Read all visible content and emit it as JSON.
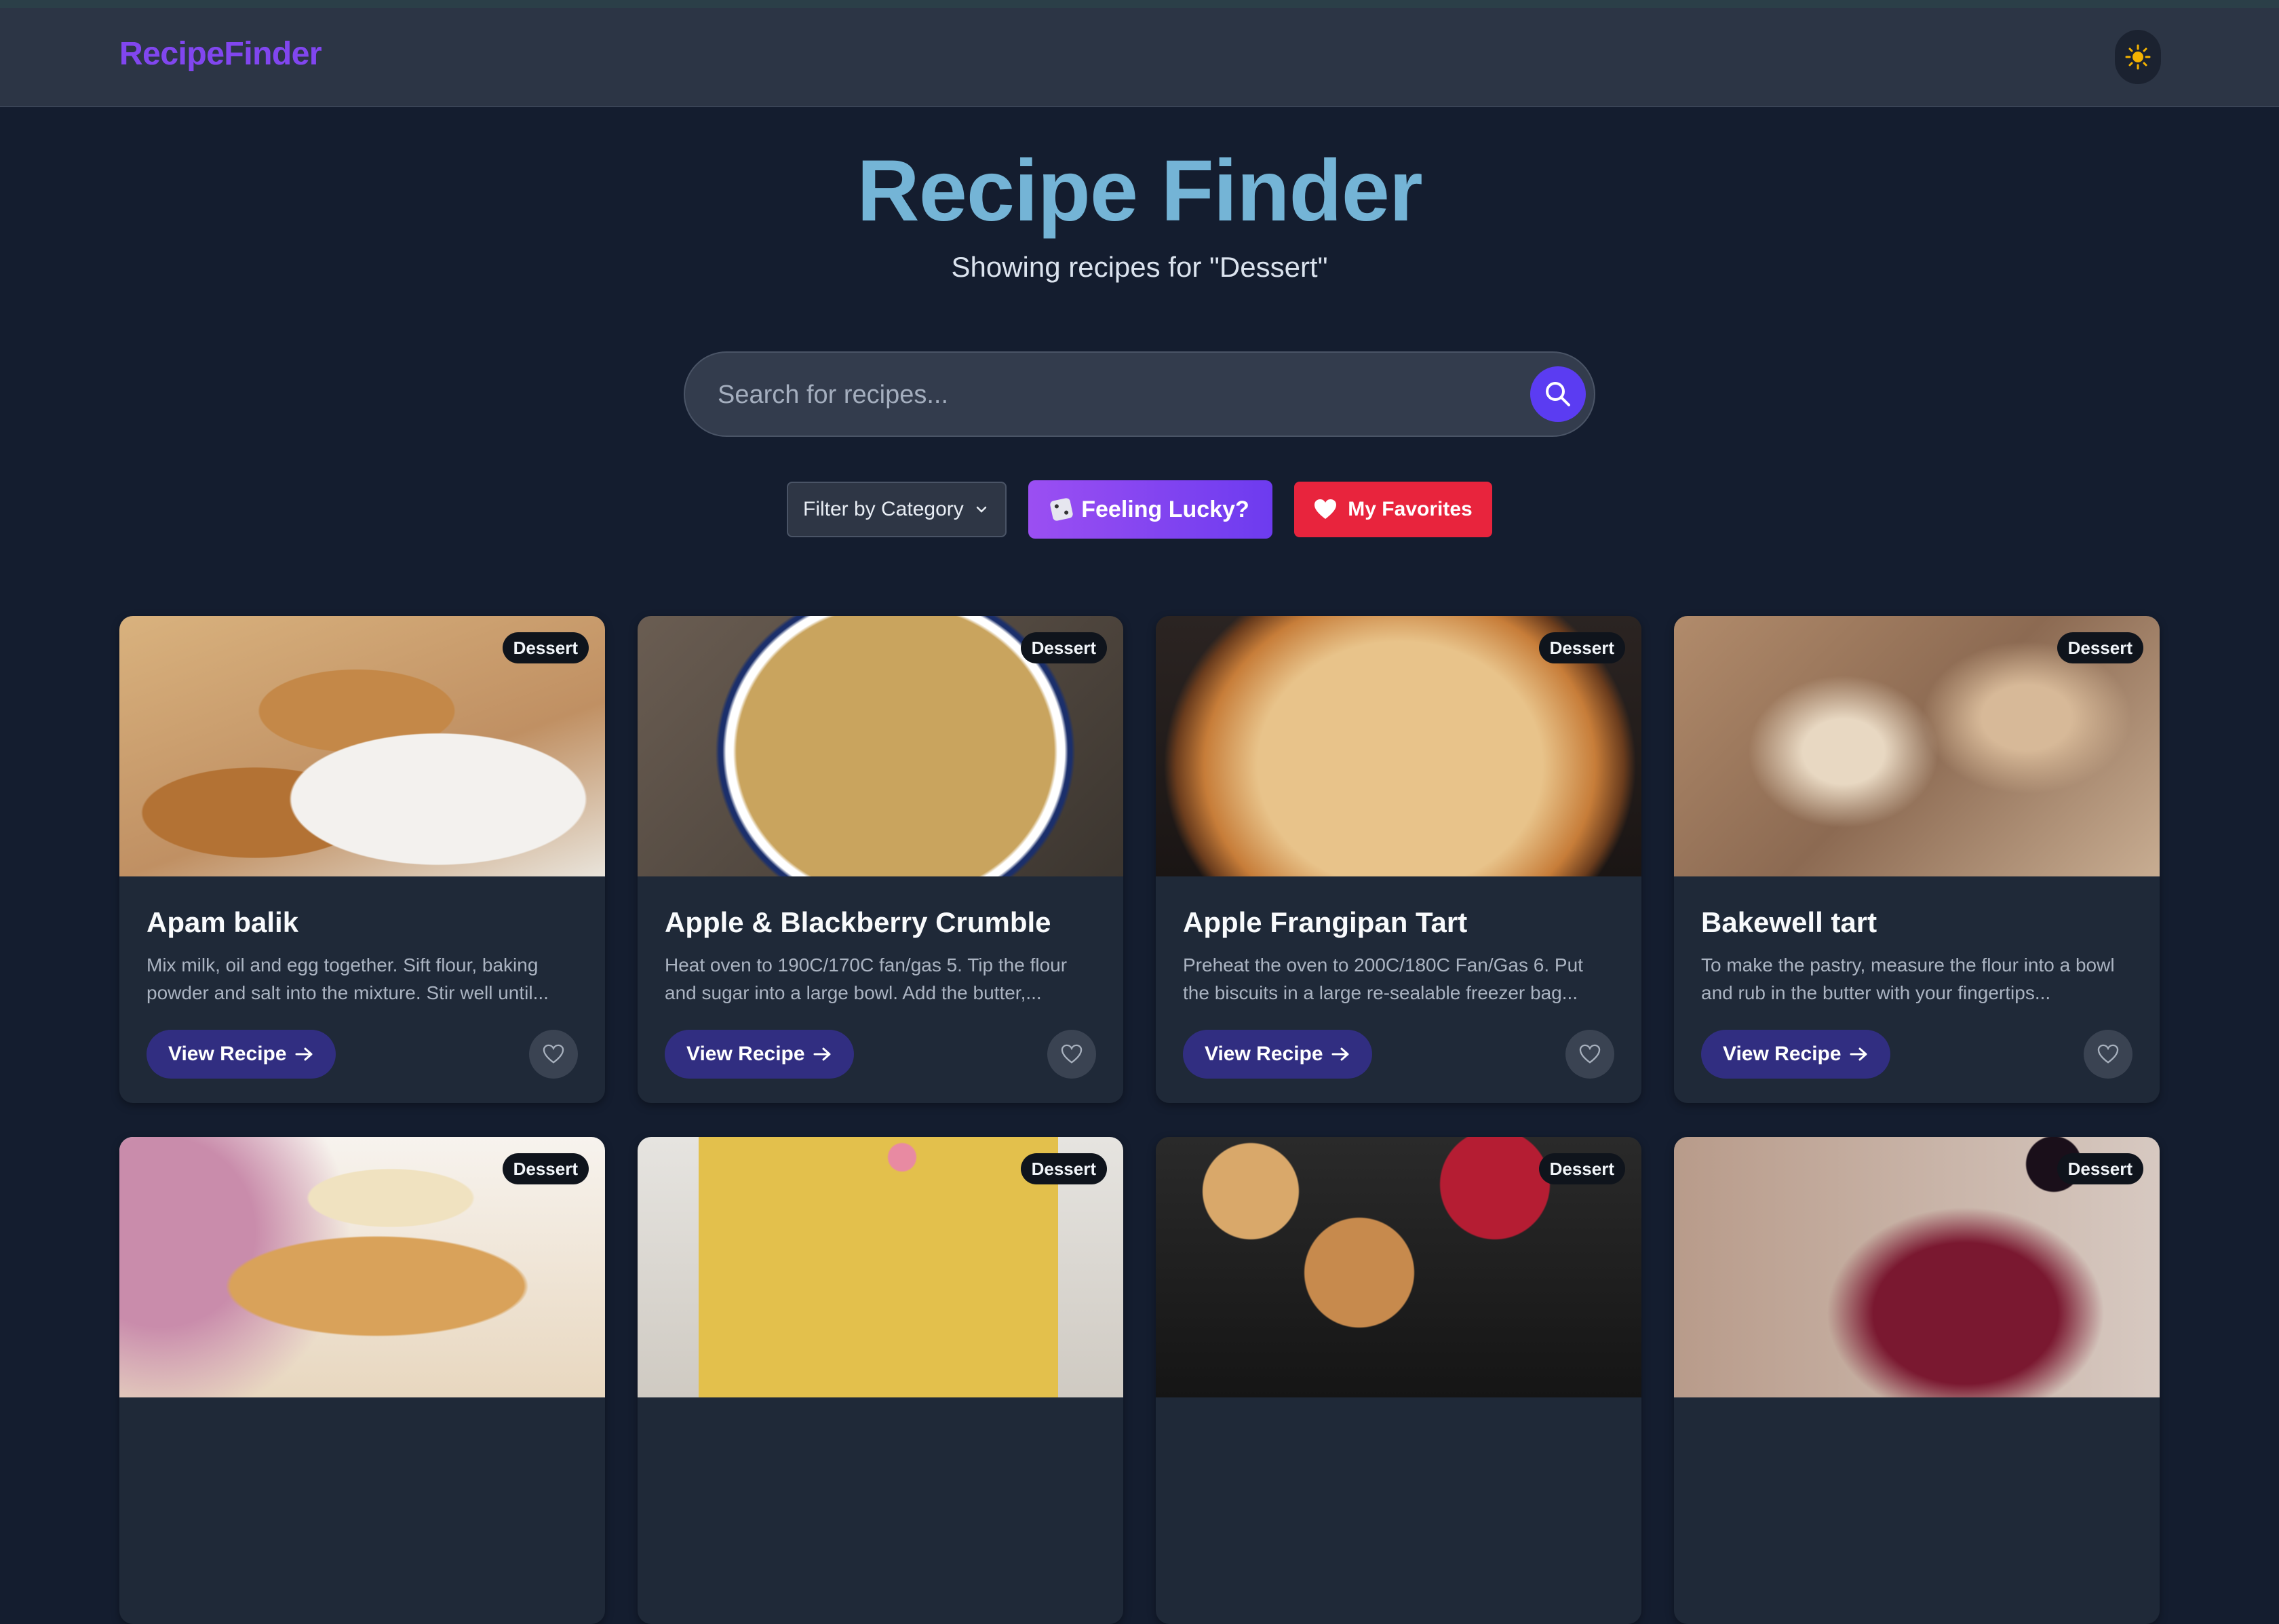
{
  "navbar": {
    "brand": "RecipeFinder",
    "theme_toggle_icon": "sun-icon"
  },
  "hero": {
    "title": "Recipe Finder",
    "subtitle": "Showing recipes for \"Dessert\""
  },
  "search": {
    "placeholder": "Search for recipes...",
    "value": ""
  },
  "controls": {
    "filter_label": "Filter by Category",
    "lucky_label": "Feeling Lucky?",
    "favorites_label": "My Favorites"
  },
  "colors": {
    "accent": "#5b3cf2",
    "favorites": "#e8243d",
    "background": "#141d2f",
    "card": "#1f2938"
  },
  "recipes": [
    {
      "title": "Apam balik",
      "category": "Dessert",
      "description": "Mix milk, oil and egg together. Sift flour, baking powder and salt into the mixture. Stir well until...",
      "action": "View Recipe"
    },
    {
      "title": "Apple & Blackberry Crumble",
      "category": "Dessert",
      "description": "Heat oven to 190C/170C fan/gas 5. Tip the flour and sugar into a large bowl. Add the butter,...",
      "action": "View Recipe"
    },
    {
      "title": "Apple Frangipan Tart",
      "category": "Dessert",
      "description": "Preheat the oven to 200C/180C Fan/Gas 6. Put the biscuits in a large re-sealable freezer bag...",
      "action": "View Recipe"
    },
    {
      "title": "Bakewell tart",
      "category": "Dessert",
      "description": "To make the pastry, measure the flour into a bowl and rub in the butter with your fingertips...",
      "action": "View Recipe"
    },
    {
      "category": "Dessert"
    },
    {
      "category": "Dessert"
    },
    {
      "category": "Dessert"
    },
    {
      "category": "Dessert"
    }
  ]
}
